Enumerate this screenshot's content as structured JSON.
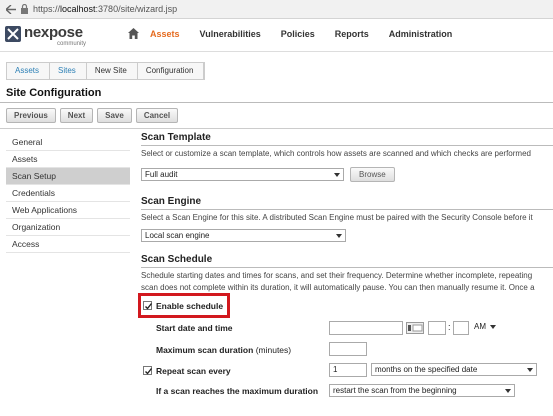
{
  "browser": {
    "url_prefix": "https://",
    "url_host": "localhost",
    "url_rest": ":3780/site/wizard.jsp"
  },
  "logo": {
    "name": "nexpose",
    "sub": "community"
  },
  "topnav": [
    "Assets",
    "Vulnerabilities",
    "Policies",
    "Reports",
    "Administration"
  ],
  "breadcrumb": [
    "Assets",
    "Sites",
    "New Site",
    "Configuration"
  ],
  "page_title": "Site Configuration",
  "buttons": {
    "previous": "Previous",
    "next": "Next",
    "save": "Save",
    "cancel": "Cancel"
  },
  "sidebar": [
    "General",
    "Assets",
    "Scan Setup",
    "Credentials",
    "Web Applications",
    "Organization",
    "Access"
  ],
  "scan_template": {
    "heading": "Scan Template",
    "desc": "Select or customize a scan template, which controls how assets are scanned and which checks are performed",
    "value": "Full audit",
    "browse": "Browse"
  },
  "scan_engine": {
    "heading": "Scan Engine",
    "desc": "Select a Scan Engine for this site. A distributed Scan Engine must be paired with the Security Console before it",
    "value": "Local scan engine"
  },
  "scan_schedule": {
    "heading": "Scan Schedule",
    "desc1": "Schedule starting dates and times for scans, and set their frequency. Determine whether incomplete, repeating",
    "desc2": "scan does not complete within its duration, it will automatically pause. You can then manually resume it. Once a",
    "enable_label": "Enable schedule",
    "start_label": "Start date and time",
    "ampm": "AM",
    "time_sep": ":",
    "max_label": "Maximum scan duration",
    "max_unit": "(minutes)",
    "repeat_label": "Repeat scan every",
    "repeat_value": "1",
    "repeat_unit": "months on the specified date",
    "reach_label": "If a scan reaches the maximum duration",
    "reach_value": "restart the scan from the beginning"
  },
  "colors": {
    "accent": "#e56b1f",
    "link": "#2b7fb5",
    "highlight": "#d2181e"
  }
}
